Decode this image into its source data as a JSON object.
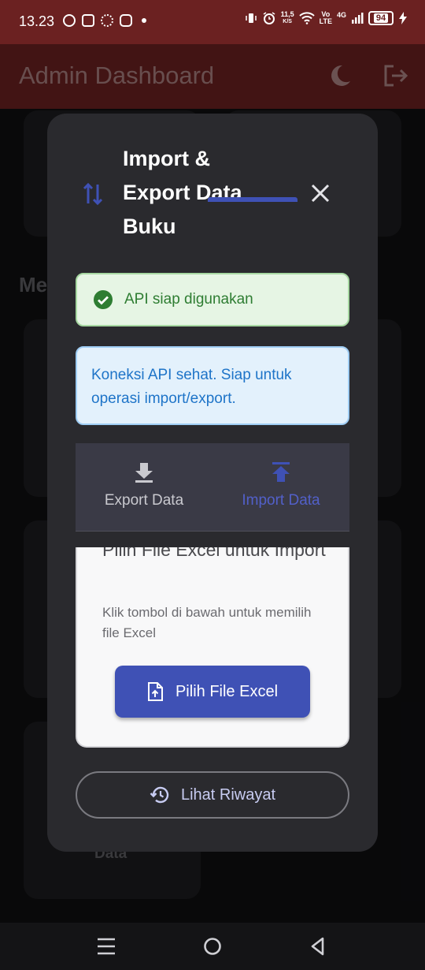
{
  "status_bar": {
    "time": "13.23",
    "speed_value": "11,5",
    "speed_unit": "K/S",
    "volte_top": "Vo",
    "volte_bottom": "LTE",
    "network": "4G",
    "battery": "94",
    "left_icons": [
      "whatsapp-icon",
      "message-icon",
      "settings-icon",
      "instagram-icon"
    ],
    "right_icons": [
      "vibrate-icon",
      "alarm-icon",
      "wifi-icon",
      "signal-icon",
      "charging-icon"
    ]
  },
  "app_bar": {
    "title": "Admin Dashboard",
    "actions": [
      "dark-mode-icon",
      "logout-icon"
    ]
  },
  "background": {
    "section_title_partial": "Me",
    "card_text_partial": "Data"
  },
  "dialog": {
    "title": "Import & Export Data Buku",
    "icon": "swap-vertical-icon",
    "status_alert": {
      "text": "API siap digunakan",
      "icon": "check-circle-icon"
    },
    "info_alert": {
      "text": "Koneksi API sehat. Siap untuk operasi import/export."
    },
    "tabs": [
      {
        "label": "Export Data",
        "icon": "download-icon",
        "selected": false
      },
      {
        "label": "Import Data",
        "icon": "upload-icon",
        "selected": true
      }
    ],
    "import_panel": {
      "title": "Pilih File Excel untuk Import",
      "description": "Klik tombol di bawah untuk memilih file Excel",
      "button_label": "Pilih File Excel",
      "button_icon": "file-upload-icon"
    },
    "history_button": {
      "label": "Lihat Riwayat",
      "icon": "history-icon"
    }
  },
  "colors": {
    "app_bar": "#6b2121",
    "dialog_bg": "#2a2a2e",
    "primary": "#3f51b5",
    "success_text": "#2e7d32",
    "info_text": "#1e74c8"
  }
}
